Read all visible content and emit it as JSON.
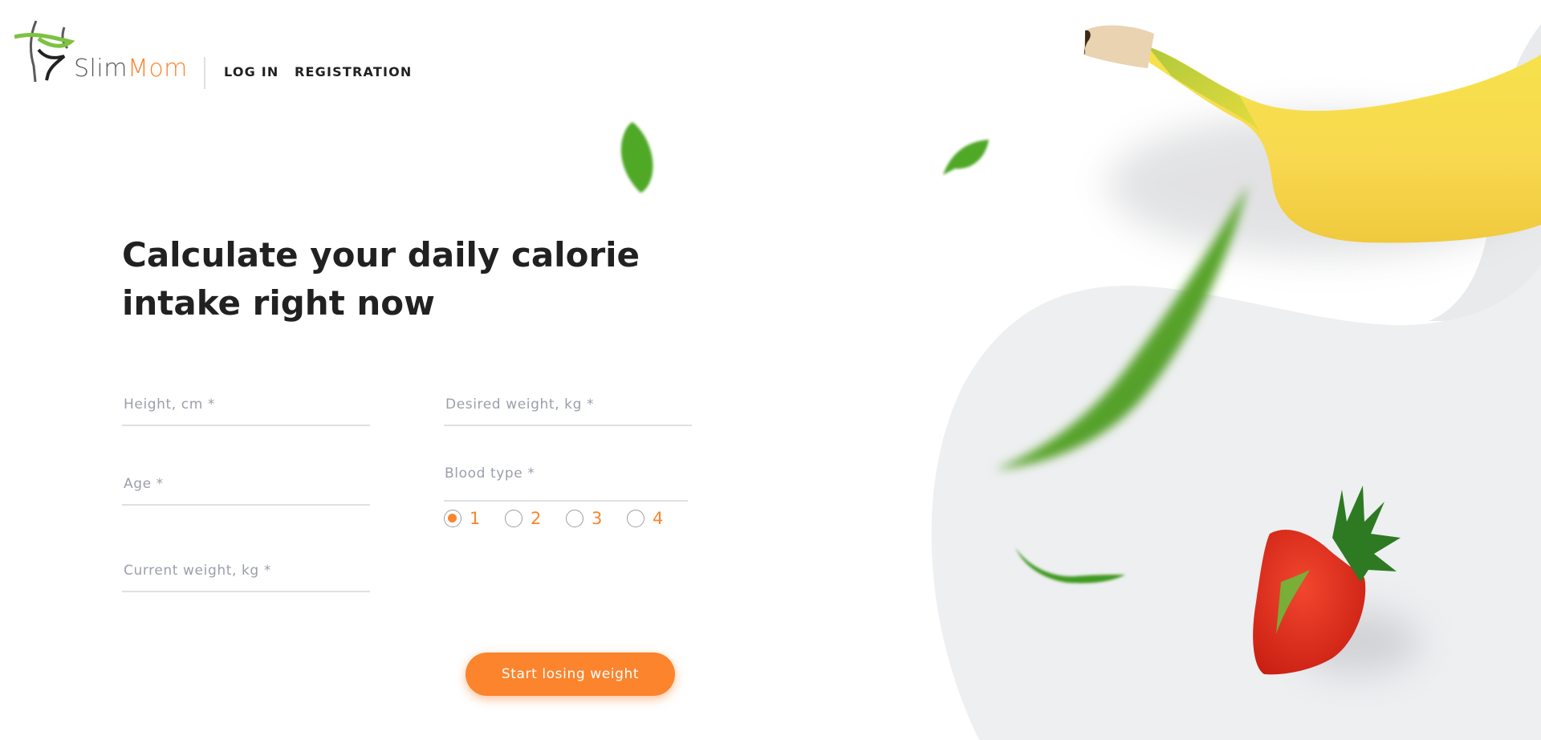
{
  "header": {
    "logo": {
      "part1": "Slim",
      "part2": "Mom"
    },
    "nav": [
      {
        "label": "LOG IN"
      },
      {
        "label": "REGISTRATION"
      }
    ]
  },
  "main": {
    "title": "Calculate your daily calorie intake right now",
    "form": {
      "height": {
        "placeholder": "Height, cm *",
        "value": ""
      },
      "desired_weight": {
        "placeholder": "Desired weight, kg *",
        "value": ""
      },
      "age": {
        "placeholder": "Age *",
        "value": ""
      },
      "current_weight": {
        "placeholder": "Current weight, kg *",
        "value": ""
      },
      "blood_type": {
        "label": "Blood type *",
        "options": [
          "1",
          "2",
          "3",
          "4"
        ],
        "selected": "1"
      },
      "submit_label": "Start losing weight"
    }
  },
  "colors": {
    "accent": "#FC842D",
    "text": "#212121",
    "muted": "#9B9FAA",
    "divider": "#E0E0E0",
    "blob": "#F0F1F3"
  },
  "decorations": [
    "banana",
    "strawberry",
    "leaf",
    "leaf",
    "leaf",
    "leaf",
    "leaf"
  ]
}
